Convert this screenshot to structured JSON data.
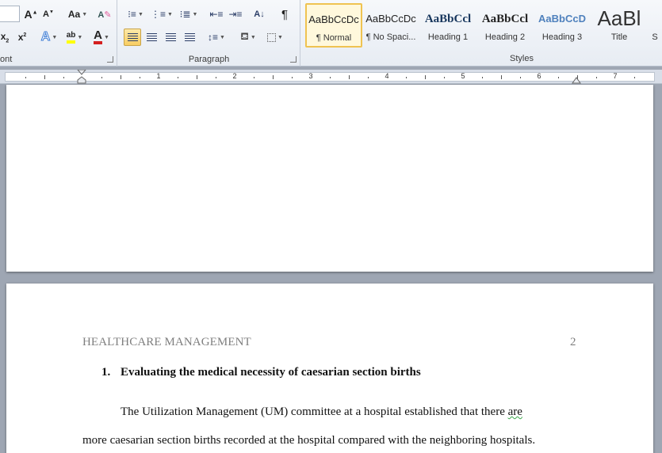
{
  "ribbon": {
    "font_group_label": "ont",
    "paragraph_group_label": "Paragraph",
    "styles_group_label": "Styles",
    "change_case_label": "Aa",
    "font_color_label": "A",
    "style_tiles": [
      {
        "preview": "AaBbCcDc",
        "name": "¶ Normal"
      },
      {
        "preview": "AaBbCcDc",
        "name": "¶ No Spaci..."
      },
      {
        "preview": "AaBbCcl",
        "name": "Heading 1"
      },
      {
        "preview": "AaBbCcl",
        "name": "Heading 2"
      },
      {
        "preview": "AaBbCcD",
        "name": "Heading 3"
      },
      {
        "preview": "AaBl",
        "name": "Title"
      },
      {
        "preview": "",
        "name": "S"
      }
    ]
  },
  "ruler": {
    "numbers": [
      "1",
      "2",
      "3",
      "4",
      "5",
      "6",
      "7"
    ]
  },
  "document": {
    "running_head": "HEALTHCARE MANAGEMENT",
    "page_number": "2",
    "heading_number": "1.",
    "heading_text": "Evaluating the medical necessity of caesarian section births",
    "body_line_1_start": "The Utilization Management (UM) committee at a hospital established that there ",
    "body_line_1_flag": "are",
    "body_line_2": "more caesarian section births recorded at the hospital compared with the neighboring hospitals."
  },
  "colors": {
    "highlight_yellow": "#ffff00",
    "font_color_red": "#d42020",
    "heading_blue": "#4f81bd",
    "active_yellow": "#f8cd62"
  }
}
